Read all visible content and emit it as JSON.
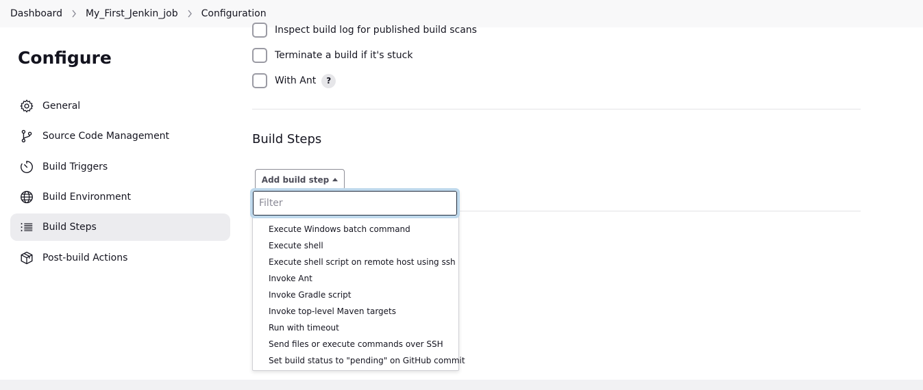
{
  "breadcrumb": {
    "items": [
      "Dashboard",
      "My_First_Jenkin_job",
      "Configuration"
    ]
  },
  "sidebar": {
    "title": "Configure",
    "items": [
      {
        "label": "General",
        "icon": "gear-icon"
      },
      {
        "label": "Source Code Management",
        "icon": "branch-icon"
      },
      {
        "label": "Build Triggers",
        "icon": "timer-icon"
      },
      {
        "label": "Build Environment",
        "icon": "globe-icon"
      },
      {
        "label": "Build Steps",
        "icon": "list-icon",
        "active": true
      },
      {
        "label": "Post-build Actions",
        "icon": "package-icon"
      }
    ]
  },
  "environment_options": {
    "items": [
      {
        "label": "Inspect build log for published build scans",
        "checked": false
      },
      {
        "label": "Terminate a build if it's stuck",
        "checked": false
      },
      {
        "label": "With Ant",
        "checked": false,
        "help": "?"
      }
    ]
  },
  "build_steps": {
    "title": "Build Steps",
    "add_button_label": "Add build step",
    "filter_placeholder": "Filter",
    "options": [
      "Execute Windows batch command",
      "Execute shell",
      "Execute shell script on remote host using ssh",
      "Invoke Ant",
      "Invoke Gradle script",
      "Invoke top-level Maven targets",
      "Run with timeout",
      "Send files or execute commands over SSH",
      "Set build status to \"pending\" on GitHub commit"
    ]
  },
  "colors": {
    "active_nav_bg": "#ececef",
    "focus_ring": "#bfd9ec",
    "text": "#14141f"
  }
}
